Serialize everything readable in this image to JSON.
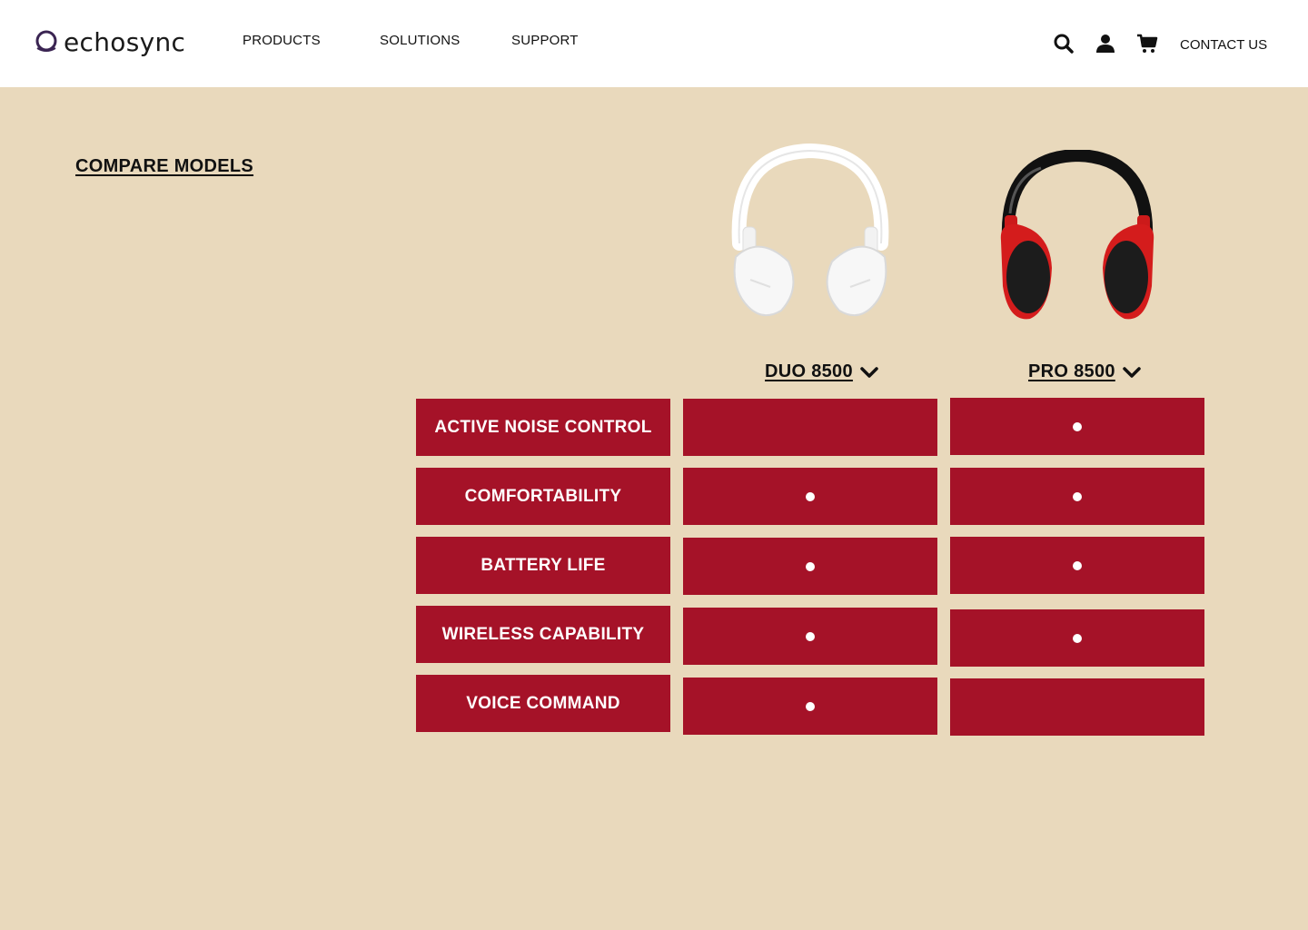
{
  "header": {
    "logo_text": "echosync",
    "nav": [
      "PRODUCTS",
      "SOLUTIONS",
      "SUPPORT"
    ],
    "icons": [
      "search-icon",
      "user-icon",
      "cart-icon"
    ],
    "contact_label": "CONTACT US"
  },
  "compare": {
    "title": "COMPARE MODELS",
    "models": [
      {
        "name": "DUO 8500",
        "image": "white-headphones"
      },
      {
        "name": "PRO 8500",
        "image": "red-headphones"
      }
    ],
    "features": [
      {
        "label": "ACTIVE NOISE CONTROL",
        "duo": false,
        "pro": true
      },
      {
        "label": "COMFORTABILITY",
        "duo": true,
        "pro": true
      },
      {
        "label": "BATTERY LIFE",
        "duo": true,
        "pro": true
      },
      {
        "label": "WIRELESS CAPABILITY",
        "duo": true,
        "pro": true
      },
      {
        "label": "VOICE COMMAND",
        "duo": true,
        "pro": false
      }
    ]
  },
  "colors": {
    "background": "#e9d9bc",
    "header": "#ffffff",
    "cell": "#a51228",
    "dot": "#ffffff"
  }
}
